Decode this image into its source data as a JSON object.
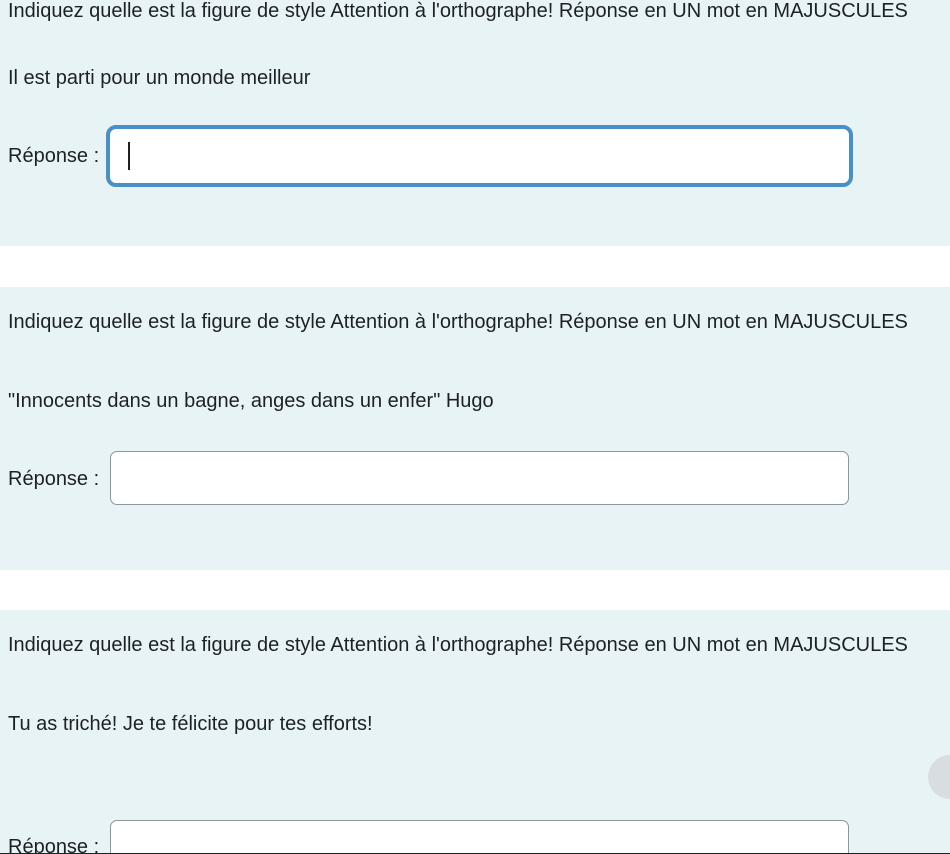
{
  "questions": [
    {
      "instruction": "Indiquez quelle est la figure de style  Attention à l'orthographe! Réponse en UN mot en MAJUSCULES",
      "prompt": "Il est parti pour un monde meilleur",
      "answer_label": "Réponse :",
      "answer_value": ""
    },
    {
      "instruction": "Indiquez quelle est la figure de style  Attention à l'orthographe! Réponse en UN mot en MAJUSCULES",
      "prompt": "\"Innocents dans un bagne, anges dans un enfer\" Hugo",
      "answer_label": "Réponse :",
      "answer_value": ""
    },
    {
      "instruction": "Indiquez quelle est la figure de style  Attention à l'orthographe! Réponse en UN mot en MAJUSCULES",
      "prompt": "Tu as triché! Je te félicite pour tes efforts!",
      "answer_label": "Réponse :",
      "answer_value": ""
    }
  ],
  "colors": {
    "question_background": "#e7f3f5",
    "focus_ring": "#4a90c8",
    "text": "#1d2125"
  }
}
